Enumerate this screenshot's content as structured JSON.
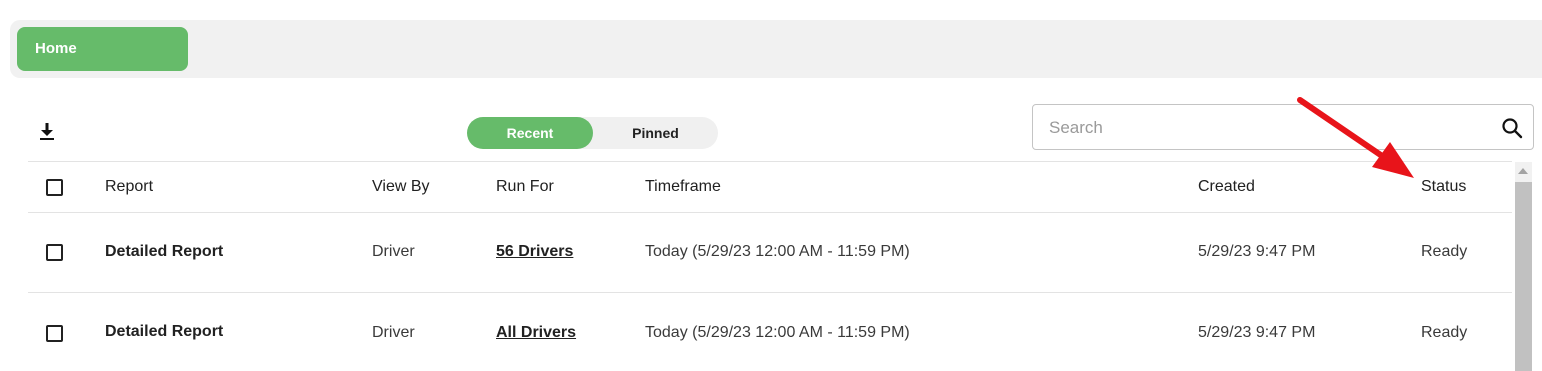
{
  "nav": {
    "home_label": "Home"
  },
  "toolbar": {
    "download_icon": "download-icon",
    "tabs": [
      {
        "label": "Recent",
        "active": true
      },
      {
        "label": "Pinned",
        "active": false
      }
    ],
    "search": {
      "placeholder": "Search",
      "value": "",
      "icon": "search-icon"
    }
  },
  "table": {
    "headers": [
      "Report",
      "View By",
      "Run For",
      "Timeframe",
      "Created",
      "Status"
    ],
    "rows": [
      {
        "report": "Detailed Report",
        "view_by": "Driver",
        "run_for": "56 Drivers",
        "timeframe": "Today (5/29/23 12:00 AM - 11:59 PM)",
        "created": "5/29/23 9:47 PM",
        "status": "Ready"
      },
      {
        "report": "Detailed Report",
        "view_by": "Driver",
        "run_for": "All Drivers",
        "timeframe": "Today (5/29/23 12:00 AM - 11:59 PM)",
        "created": "5/29/23 9:47 PM",
        "status": "Ready"
      }
    ]
  },
  "colors": {
    "accent": "#66bb6a",
    "annotation_arrow": "#e8141a",
    "topbar_bg": "#f1f1f1"
  }
}
